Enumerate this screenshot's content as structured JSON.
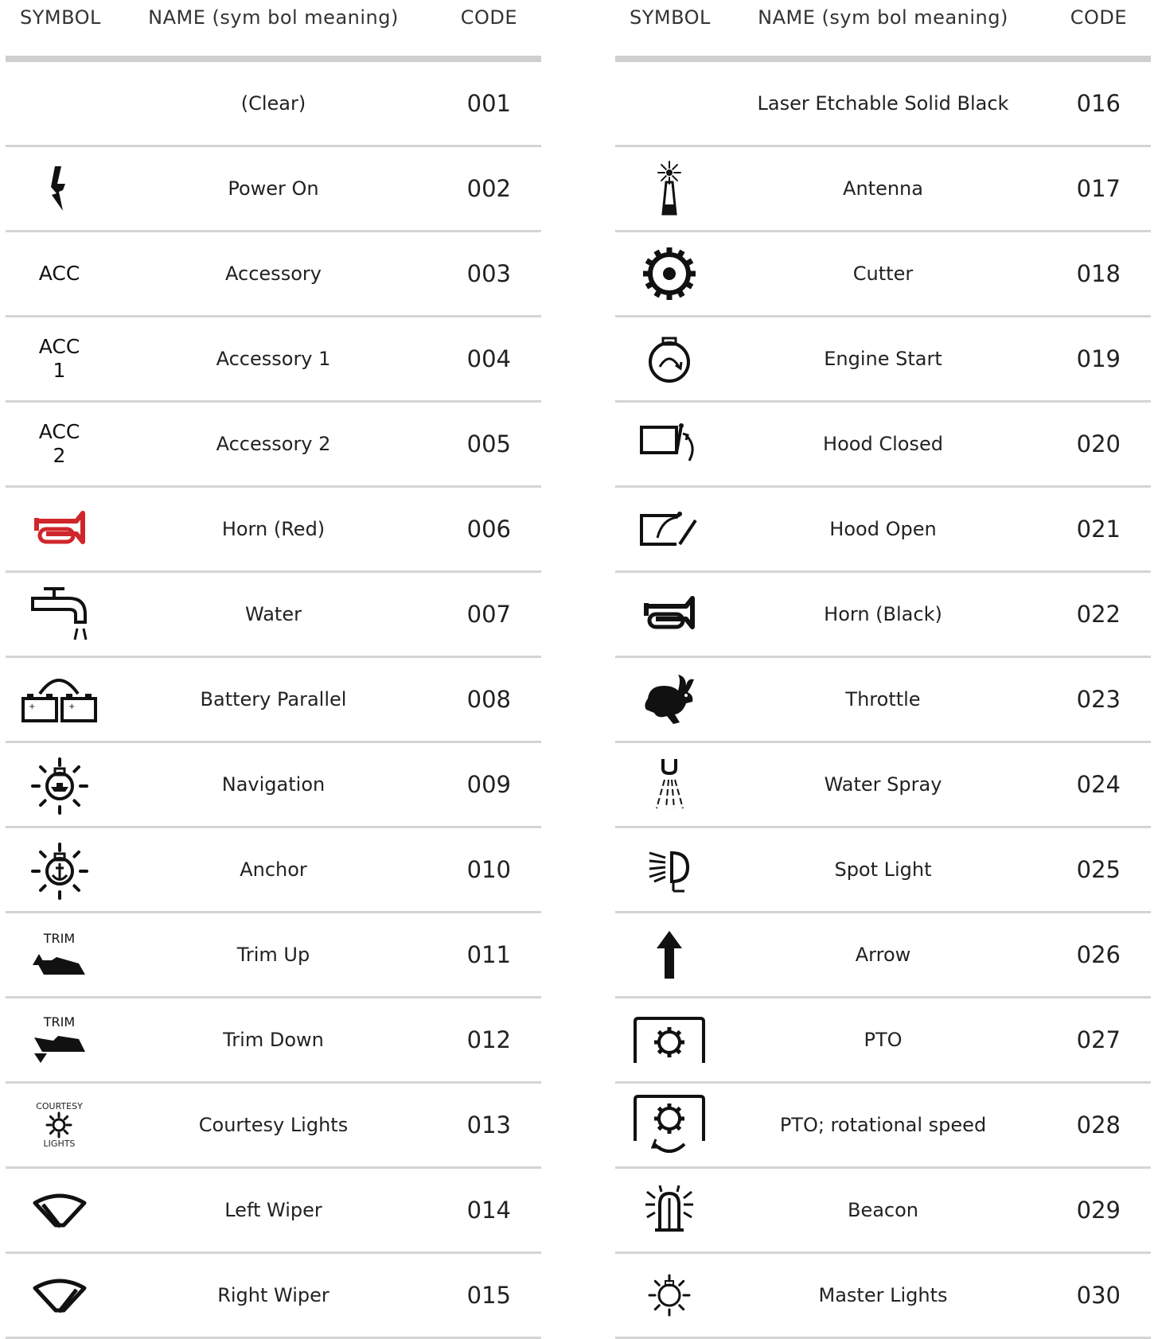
{
  "header": {
    "symbol_label": "SYMBOL",
    "name_label": "NAME (sym bol meaning)",
    "code_label": "CODE"
  },
  "accent_color": "#d0262b",
  "rows": [
    {
      "name": "(Clear)",
      "code": "001",
      "icon": "none"
    },
    {
      "name": "Power On",
      "code": "002",
      "icon": "lightning-icon"
    },
    {
      "name": "Accessory",
      "code": "003",
      "icon": "text",
      "symbol_text": "ACC"
    },
    {
      "name": "Accessory 1",
      "code": "004",
      "icon": "text",
      "symbol_text": "ACC",
      "symbol_sub": "1"
    },
    {
      "name": "Accessory 2",
      "code": "005",
      "icon": "text",
      "symbol_text": "ACC",
      "symbol_sub": "2"
    },
    {
      "name": "Horn (Red)",
      "code": "006",
      "icon": "horn-icon",
      "color": "#d0262b"
    },
    {
      "name": "Water",
      "code": "007",
      "icon": "faucet-icon"
    },
    {
      "name": "Battery Parallel",
      "code": "008",
      "icon": "battery-parallel-icon"
    },
    {
      "name": "Navigation",
      "code": "009",
      "icon": "navigation-light-icon"
    },
    {
      "name": "Anchor",
      "code": "010",
      "icon": "anchor-light-icon"
    },
    {
      "name": "Trim Up",
      "code": "011",
      "icon": "trim-up-icon",
      "symbol_text": "TRIM"
    },
    {
      "name": "Trim Down",
      "code": "012",
      "icon": "trim-down-icon",
      "symbol_text": "TRIM"
    },
    {
      "name": "Courtesy Lights",
      "code": "013",
      "icon": "courtesy-lights-icon",
      "symbol_text": "COURTESY",
      "symbol_sub": "LIGHTS"
    },
    {
      "name": "Left Wiper",
      "code": "014",
      "icon": "left-wiper-icon"
    },
    {
      "name": "Right Wiper",
      "code": "015",
      "icon": "right-wiper-icon"
    },
    {
      "name": "Laser Etchable Solid Black",
      "code": "016",
      "icon": "none"
    },
    {
      "name": "Antenna",
      "code": "017",
      "icon": "antenna-icon"
    },
    {
      "name": "Cutter",
      "code": "018",
      "icon": "cutter-icon"
    },
    {
      "name": "Engine Start",
      "code": "019",
      "icon": "engine-start-icon"
    },
    {
      "name": "Hood Closed",
      "code": "020",
      "icon": "hood-closed-icon"
    },
    {
      "name": "Hood Open",
      "code": "021",
      "icon": "hood-open-icon"
    },
    {
      "name": "Horn (Black)",
      "code": "022",
      "icon": "horn-icon",
      "color": "#111111"
    },
    {
      "name": "Throttle",
      "code": "023",
      "icon": "rabbit-icon"
    },
    {
      "name": "Water Spray",
      "code": "024",
      "icon": "water-spray-icon"
    },
    {
      "name": "Spot Light",
      "code": "025",
      "icon": "spot-light-icon"
    },
    {
      "name": "Arrow",
      "code": "026",
      "icon": "arrow-up-icon"
    },
    {
      "name": "PTO",
      "code": "027",
      "icon": "pto-icon"
    },
    {
      "name": "PTO; rotational speed",
      "code": "028",
      "icon": "pto-rotational-icon"
    },
    {
      "name": "Beacon",
      "code": "029",
      "icon": "beacon-icon"
    },
    {
      "name": "Master Lights",
      "code": "030",
      "icon": "master-lights-icon"
    }
  ]
}
